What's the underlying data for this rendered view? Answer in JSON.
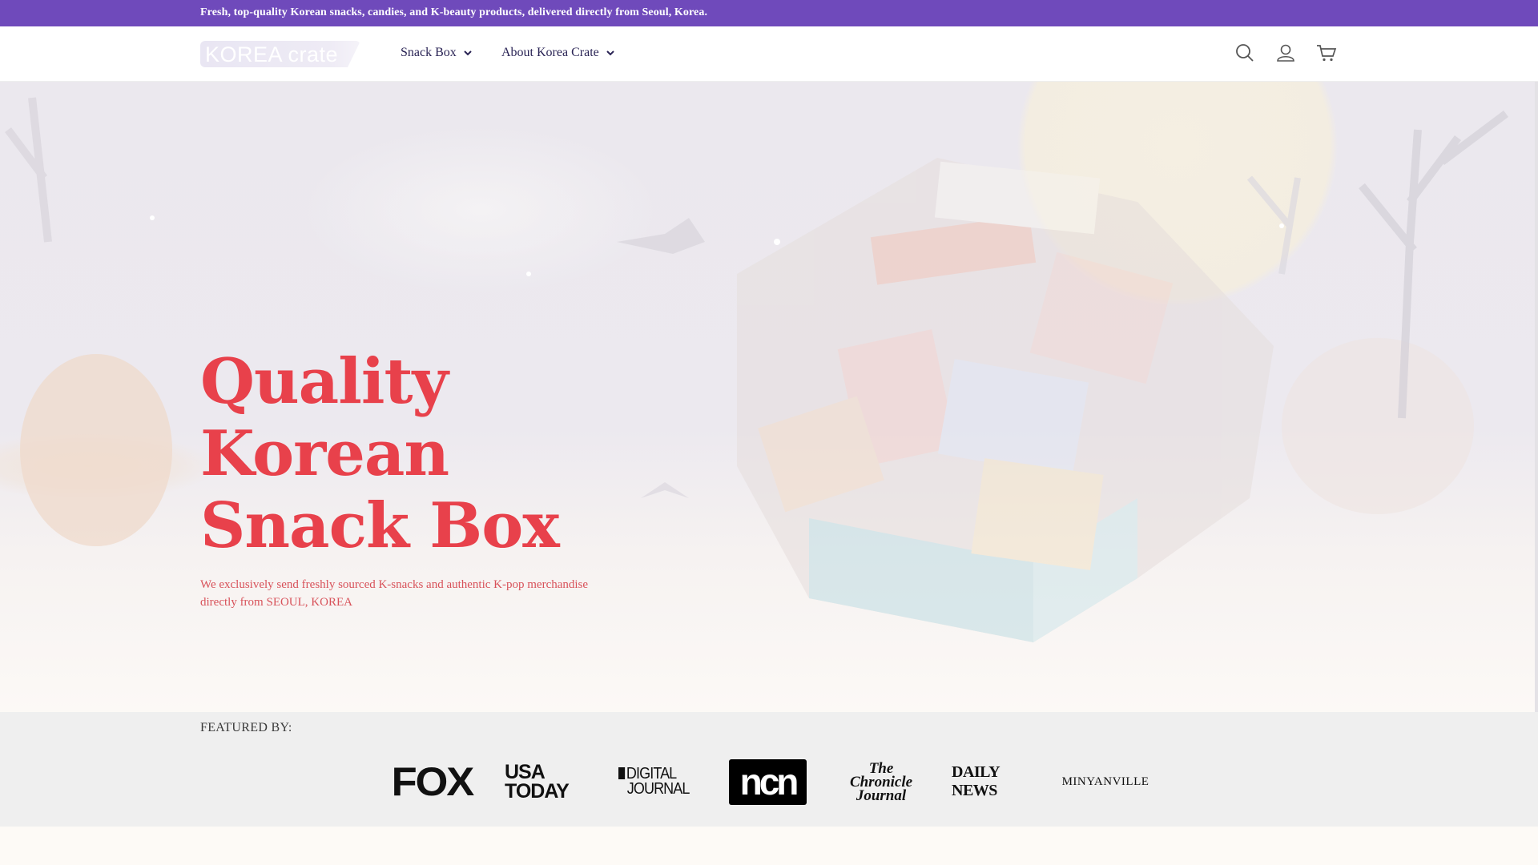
{
  "announcement": {
    "text": "Fresh, top-quality Korean snacks, candies, and K-beauty products, delivered directly from Seoul, Korea."
  },
  "header": {
    "logo_text": "KOREA crate",
    "nav": [
      {
        "label": "Snack Box"
      },
      {
        "label": "About Korea Crate"
      }
    ],
    "icons": [
      "search-icon",
      "account-icon",
      "cart-icon"
    ]
  },
  "hero": {
    "title_lines": [
      "Quality",
      "Korean",
      "Snack Box"
    ],
    "subtitle": "We exclusively send freshly sourced K-snacks and authentic K-pop merchandise directly from SEOUL, KOREA"
  },
  "featured": {
    "label": "FEATURED BY:",
    "outlets": {
      "fox": "FOX",
      "usa_today_1": "USA",
      "usa_today_2": "TODAY",
      "digital_journal_1": "DIGITAL",
      "digital_journal_2": "JOURNAL",
      "ncn": "ncn",
      "chronicle_1": "The Chronicle",
      "chronicle_2": "Journal",
      "daily_news": "DAILY NEWS",
      "minyanville": "MINYANVILLE"
    }
  },
  "colors": {
    "announcement_bg": "#6f4abb",
    "title": "#e8414b",
    "nav_text": "#2a2455",
    "featured_bg": "#efefef"
  }
}
